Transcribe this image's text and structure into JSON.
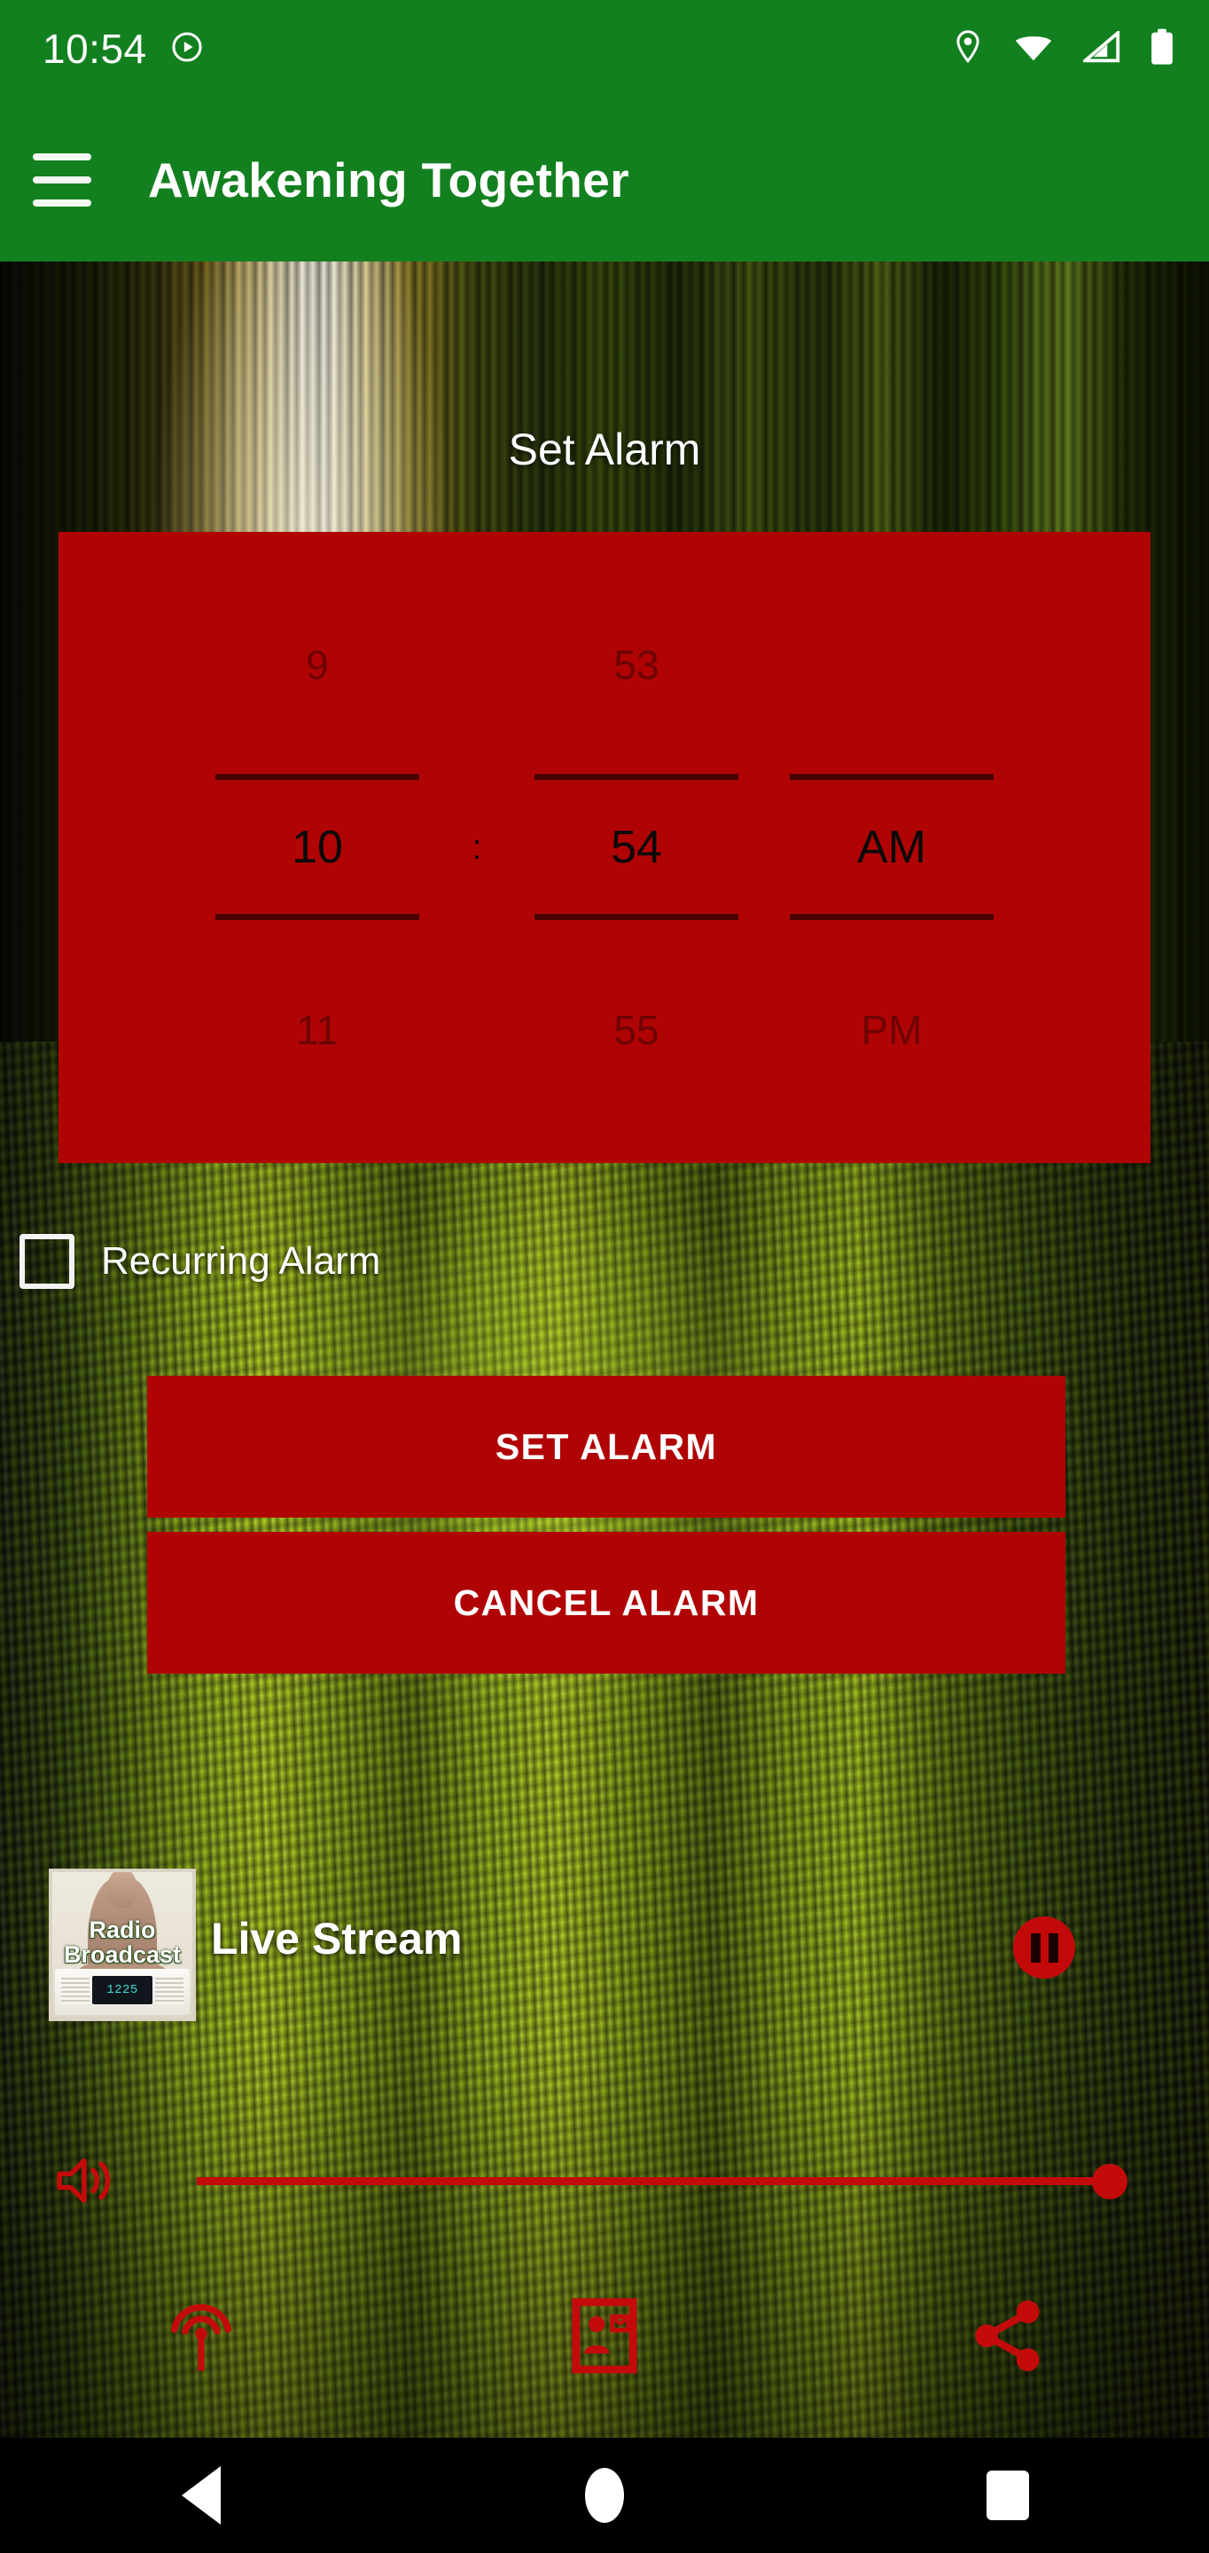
{
  "status_bar": {
    "time": "10:54",
    "icons": [
      "play-circle-icon",
      "location-pin-icon",
      "wifi-icon",
      "cellular-signal-icon",
      "battery-icon"
    ],
    "background_color": "#13801F"
  },
  "app_bar": {
    "menu_icon": "hamburger-menu-icon",
    "title": "Awakening Together",
    "background_color": "#13801F"
  },
  "main": {
    "heading": "Set Alarm",
    "time_picker": {
      "panel_color": "#B00404",
      "separator": ":",
      "previous": {
        "hour": "9",
        "minute": "53",
        "meridiem": ""
      },
      "selected": {
        "hour": "10",
        "minute": "54",
        "meridiem": "AM"
      },
      "next": {
        "hour": "11",
        "minute": "55",
        "meridiem": "PM"
      }
    },
    "recurring": {
      "label": "Recurring Alarm",
      "checked": false
    },
    "buttons": {
      "set_alarm": "SET ALARM",
      "cancel_alarm": "CANCEL ALARM",
      "color": "#B00404"
    }
  },
  "player": {
    "album_art": {
      "line1": "Radio",
      "line2": "Broadcast",
      "radio_display": "1225",
      "icon": "buddha-radio-album-art"
    },
    "title": "Live Stream",
    "transport_icon": "pause-icon",
    "accent_color": "#C20A0A",
    "volume": {
      "icon": "volume-up-icon",
      "value": 100
    },
    "actions": [
      {
        "name": "broadcast-icon",
        "label": "broadcast"
      },
      {
        "name": "contact-card-icon",
        "label": "contact"
      },
      {
        "name": "share-icon",
        "label": "share"
      }
    ]
  },
  "nav_bar": {
    "back": "back-button",
    "home": "home-button",
    "recents": "recents-button"
  }
}
